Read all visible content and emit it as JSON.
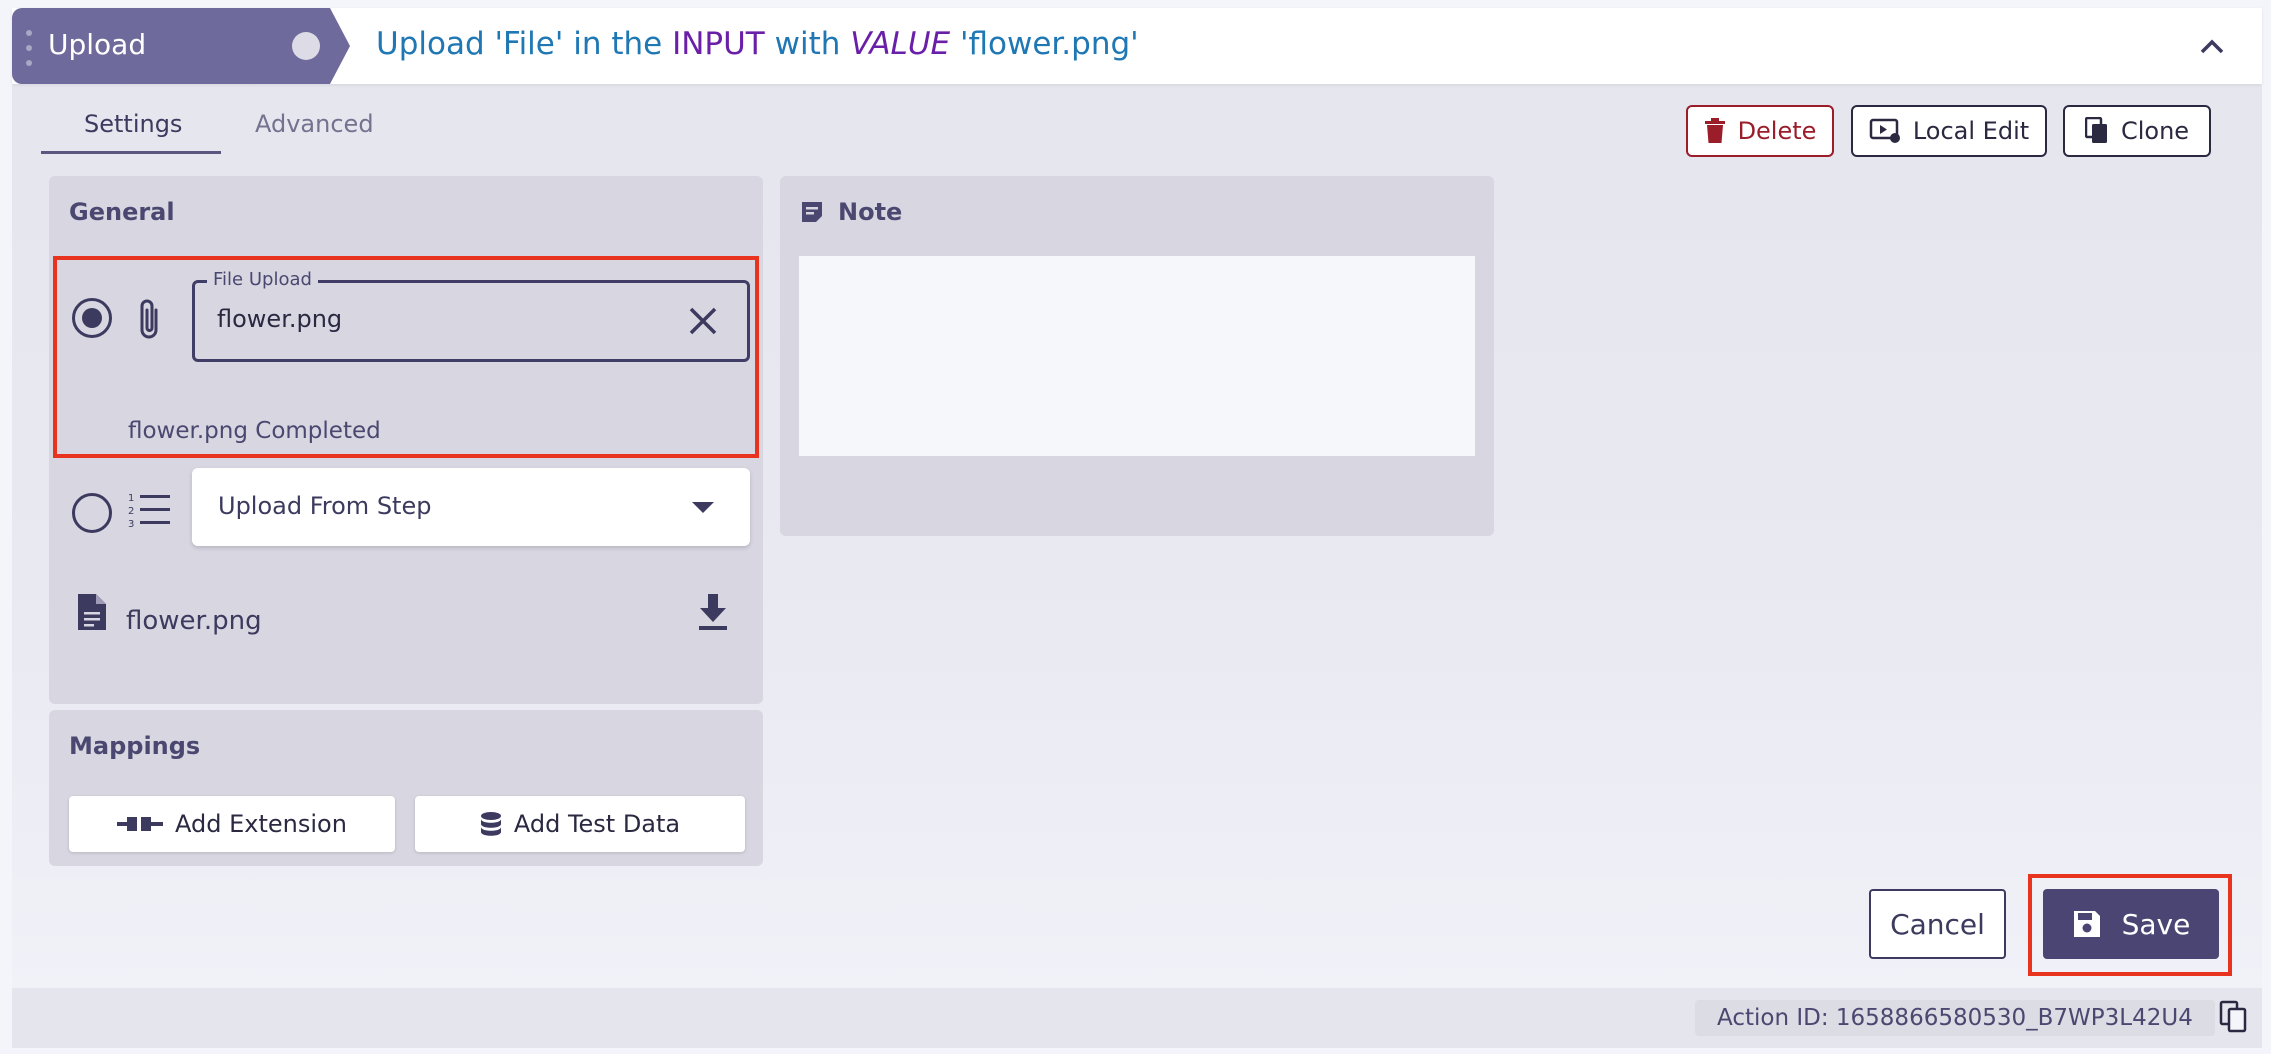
{
  "header": {
    "action_label": "Upload",
    "desc_part1": "Upload 'File' in the ",
    "desc_input": "INPUT",
    "desc_with": " with ",
    "desc_value": "VALUE",
    "desc_file": " 'flower.png'"
  },
  "tabs": {
    "settings": "Settings",
    "advanced": "Advanced"
  },
  "toolbar": {
    "delete_label": "Delete",
    "local_edit_label": "Local Edit",
    "clone_label": "Clone"
  },
  "general": {
    "title": "General",
    "file_upload_legend": "File Upload",
    "file_upload_value": "flower.png",
    "upload_status": "flower.png Completed",
    "upload_from_step_value": "Upload From Step",
    "file_name": "flower.png"
  },
  "mappings": {
    "title": "Mappings",
    "add_extension": "Add Extension",
    "add_test_data": "Add Test Data"
  },
  "note": {
    "title": "Note"
  },
  "footer": {
    "cancel_label": "Cancel",
    "save_label": "Save",
    "action_id": "Action ID: 1658866580530_B7WP3L42U4"
  },
  "colors": {
    "accent": "#4b4574",
    "highlight": "#e8331f",
    "delete": "#9b1d2a",
    "link": "#1f77b4",
    "keyword": "#6a1fa8"
  }
}
